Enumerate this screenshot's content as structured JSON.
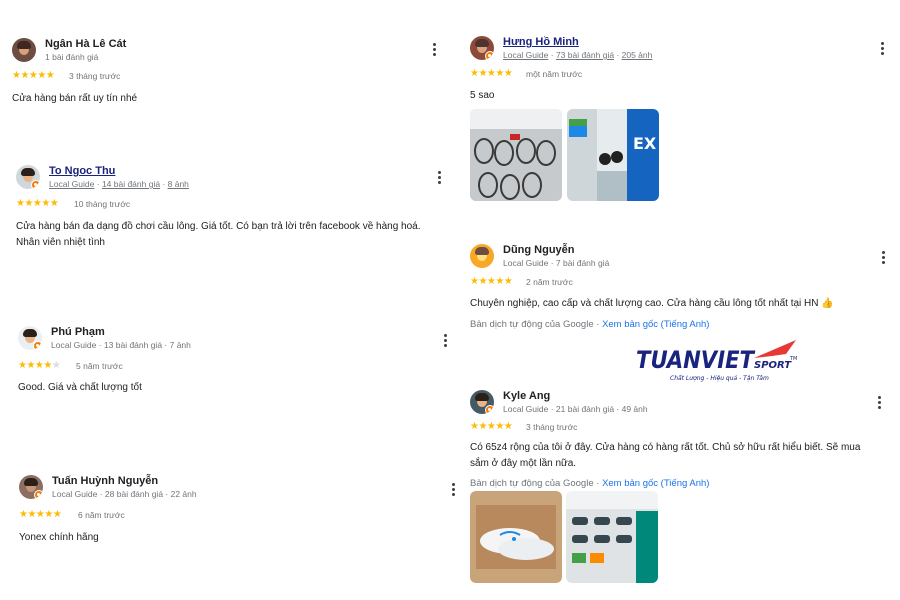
{
  "reviews": [
    {
      "name": "Ngân Hà Lê Cát",
      "meta": "1 bài đánh giá",
      "stars": "★★★★★",
      "time": "3 tháng trước",
      "text": "Cửa hàng bán rất uy tín nhé"
    },
    {
      "name": "To Ngoc Thu",
      "meta_guide": "Local Guide",
      "meta_reviews": "14 bài đánh giá",
      "meta_photos": "8 ảnh",
      "stars": "★★★★★",
      "time": "10 tháng trước",
      "text": "Cửa hàng bán đa dạng đồ chơi cầu lông. Giá tốt. Có bạn trả lời trên facebook về hàng hoá. Nhân viên nhiệt tình"
    },
    {
      "name": "Phú Phạm",
      "meta": "Local Guide · 13 bài đánh giá · 7 ảnh",
      "stars": "★★★★",
      "stars_empty": "★",
      "time": "5 năm trước",
      "text": "Good. Giá và chất lượng tốt"
    },
    {
      "name": "Tuấn Huỳnh Nguyễn",
      "meta": "Local Guide · 28 bài đánh giá · 22 ảnh",
      "stars": "★★★★★",
      "time": "6 năm trước",
      "text": "Yonex chính hãng"
    },
    {
      "name": "Hưng Hồ Minh",
      "meta_guide": "Local Guide",
      "meta_reviews": "73 bài đánh giá",
      "meta_photos": "205 ảnh",
      "stars": "★★★★★",
      "time": "một năm trước",
      "text": "5 sao"
    },
    {
      "name": "Dũng Nguyễn",
      "meta": "Local Guide · 7 bài đánh giá",
      "stars": "★★★★★",
      "time": "2 năm trước",
      "text": "Chuyên nghiệp, cao cấp và chất lượng cao. Cửa hàng cầu lông tốt nhất tại HN 👍",
      "translated": "Bản dịch tự động của Google ·",
      "original_link": "Xem bản gốc (Tiếng Anh)"
    },
    {
      "name": "Kyle Ang",
      "meta": "Local Guide · 21 bài đánh giá · 49 ảnh",
      "stars": "★★★★★",
      "time": "3 tháng trước",
      "text": "Có 65z4 rộng của tôi ở đây. Cửa hàng có hàng rất tốt. Chủ sở hữu rất hiểu biết. Sẽ mua sắm ở đây một lần nữa.",
      "translated": "Bản dịch tự động của Google ·",
      "original_link": "Xem bản gốc (Tiếng Anh)"
    }
  ],
  "logo": {
    "brand": "TUANVIET",
    "sport": "SPORT",
    "tm": "TM",
    "tagline": "Chất Lượng - Hiệu quả - Tận Tâm",
    "color": "#1a237e",
    "accent": "#e53935"
  }
}
